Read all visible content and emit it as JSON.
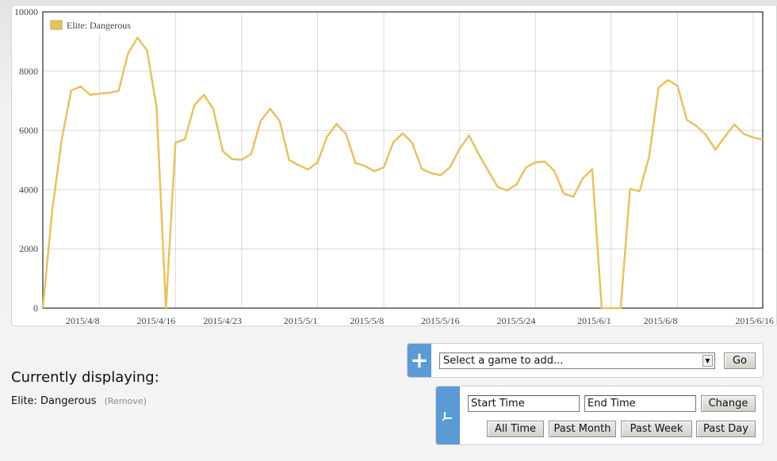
{
  "chart_data": {
    "type": "line",
    "series": [
      {
        "name": "Elite: Dangerous",
        "color": "#e8c35a",
        "values": [
          0,
          3300,
          5700,
          7350,
          7480,
          7200,
          7240,
          7270,
          7330,
          8600,
          9130,
          8700,
          6800,
          0,
          5580,
          5700,
          6850,
          7200,
          6720,
          5300,
          5030,
          5010,
          5200,
          6320,
          6730,
          6320,
          5000,
          4830,
          4680,
          4920,
          5780,
          6220,
          5880,
          4900,
          4800,
          4620,
          4750,
          5600,
          5900,
          5580,
          4700,
          4560,
          4490,
          4760,
          5380,
          5830,
          5200,
          4650,
          4100,
          3970,
          4170,
          4750,
          4920,
          4950,
          4630,
          3860,
          3760,
          4380,
          4690,
          0,
          0,
          0,
          4030,
          3940,
          5100,
          7440,
          7700,
          7500,
          6350,
          6150,
          5850,
          5350,
          5780,
          6200,
          5880,
          5760,
          5680
        ]
      }
    ],
    "x_ticks": [
      "2015/4/8",
      "2015/4/16",
      "2015/4/23",
      "2015/5/1",
      "2015/5/8",
      "2015/5/16",
      "2015/5/24",
      "2015/6/1",
      "2015/6/8",
      "2015/6/16"
    ],
    "y_ticks": [
      "0",
      "2000",
      "4000",
      "6000",
      "8000",
      "10000"
    ],
    "ylim": [
      0,
      10000
    ],
    "grid": true,
    "legend_position": "top-left"
  },
  "current": {
    "title": "Currently displaying:",
    "game": "Elite: Dangerous",
    "remove": "(Remove)"
  },
  "add": {
    "select_value": "Select a game to add...",
    "go": "Go"
  },
  "time": {
    "start_value": "Start Time",
    "end_value": "End Time",
    "change": "Change",
    "all_time": "All Time",
    "past_month": "Past Month",
    "past_week": "Past Week",
    "past_day": "Past Day"
  },
  "colors": {
    "accent": "#5b9bd5",
    "line": "#e8c35a"
  }
}
